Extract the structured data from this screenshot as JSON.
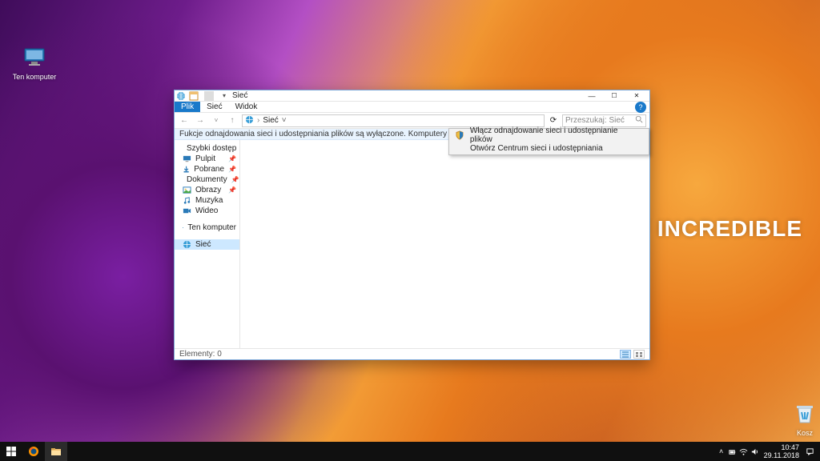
{
  "wallpaper_text": "EARCH OF INCREDIBLE",
  "desktop": {
    "this_pc": "Ten komputer",
    "recycle": "Kosz"
  },
  "window": {
    "title": "Sieć",
    "qat_dropdown": "▾",
    "ribbon": {
      "file": "Plik",
      "network": "Sieć",
      "view": "Widok",
      "help": "?"
    },
    "nav": {
      "back": "←",
      "forward": "→",
      "up": "↑"
    },
    "breadcrumb": {
      "root_icon": "🌐",
      "sep": "›",
      "current": "Sieć"
    },
    "addr_dropdown": "˅",
    "refresh": "⟳",
    "search_placeholder": "Przeszukaj: Sieć",
    "infobar_text": "Fukcje odnajdowania sieci i udostępniania plików są wyłączone. Komputery i urządzenia sie",
    "infobar_close": "×",
    "sidebar": {
      "quick": "Szybki dostęp",
      "items": [
        {
          "icon": "desktop",
          "label": "Pulpit",
          "pinned": true
        },
        {
          "icon": "download",
          "label": "Pobrane",
          "pinned": true
        },
        {
          "icon": "docs",
          "label": "Dokumenty",
          "pinned": true
        },
        {
          "icon": "pics",
          "label": "Obrazy",
          "pinned": true
        },
        {
          "icon": "music",
          "label": "Muzyka",
          "pinned": false
        },
        {
          "icon": "video",
          "label": "Wideo",
          "pinned": false
        }
      ],
      "this_pc": "Ten komputer",
      "network": "Sieć"
    },
    "context": {
      "item1": "Włącz odnajdowanie sieci i udostępnianie plików",
      "item2": "Otwórz Centrum sieci i udostępniania"
    },
    "status": {
      "count": "Elementy: 0"
    },
    "ctrl": {
      "min": "—",
      "max": "☐",
      "close": "✕"
    }
  },
  "taskbar": {
    "tray_up": "˄",
    "time": "10:47",
    "date": "29.11.2018"
  }
}
